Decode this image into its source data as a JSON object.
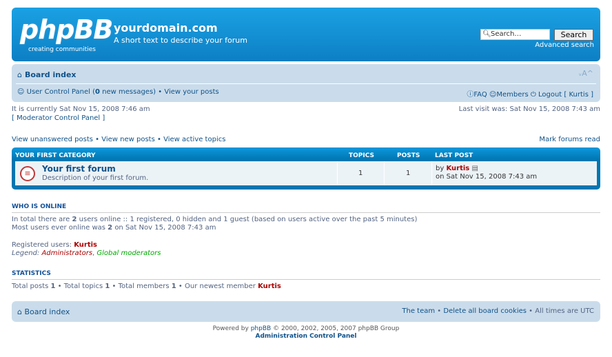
{
  "header": {
    "logo_text": "phpBB",
    "logo_tagline": "creating communities",
    "site_title": "yourdomain.com",
    "site_description": "A short text to describe your forum",
    "search_placeholder": "Search…",
    "search_button": "Search",
    "advanced_search": "Advanced search"
  },
  "navbar": {
    "board_index": "Board index",
    "font_size": "ᵥA^",
    "ucp_label": "User Control Panel",
    "new_messages_count": "0",
    "new_messages_label": "new messages",
    "view_posts": "View your posts",
    "faq": "FAQ",
    "members": "Members",
    "logout": "Logout",
    "username": "Kurtis"
  },
  "info": {
    "current_time": "It is currently Sat Nov 15, 2008 7:46 am",
    "mcp": "Moderator Control Panel",
    "last_visit": "Last visit was: Sat Nov 15, 2008 7:43 am",
    "unanswered": "View unanswered posts",
    "new_posts": "View new posts",
    "active_topics": "View active topics",
    "mark_read": "Mark forums read"
  },
  "forum_table": {
    "category": "YOUR FIRST CATEGORY",
    "col_topics": "TOPICS",
    "col_posts": "POSTS",
    "col_last_post": "LAST POST",
    "forum_title": "Your first forum",
    "forum_desc": "Description of your first forum.",
    "topics": "1",
    "posts": "1",
    "last_by": "by",
    "last_user": "Kurtis",
    "last_on": "on Sat Nov 15, 2008 7:43 am"
  },
  "online": {
    "title": "WHO IS ONLINE",
    "line1_a": "In total there are",
    "users_online": "2",
    "line1_b": "users online :: 1 registered, 0 hidden and 1 guest (based on users active over the past 5 minutes)",
    "line2_a": "Most users ever online was",
    "max_users": "2",
    "line2_b": "on Sat Nov 15, 2008 7:43 am",
    "registered_label": "Registered users:",
    "registered_user": "Kurtis",
    "legend_label": "Legend:",
    "legend_admins": "Administrators",
    "legend_mods": "Global moderators"
  },
  "stats": {
    "title": "STATISTICS",
    "posts_label": "Total posts",
    "posts": "1",
    "topics_label": "Total topics",
    "topics": "1",
    "members_label": "Total members",
    "members": "1",
    "newest_label": "Our newest member",
    "newest": "Kurtis"
  },
  "footer": {
    "board_index": "Board index",
    "team": "The team",
    "delete_cookies": "Delete all board cookies",
    "timezone": "All times are UTC",
    "powered_a": "Powered by",
    "powered_link": "phpBB",
    "powered_b": "© 2000, 2002, 2005, 2007 phpBB Group",
    "acp": "Administration Control Panel"
  },
  "colors": {
    "header_blue": "#0d7fc4",
    "navbar_bg": "#cadceb",
    "link": "#105289",
    "admin_red": "#aa0000",
    "mod_green": "#00aa00"
  }
}
